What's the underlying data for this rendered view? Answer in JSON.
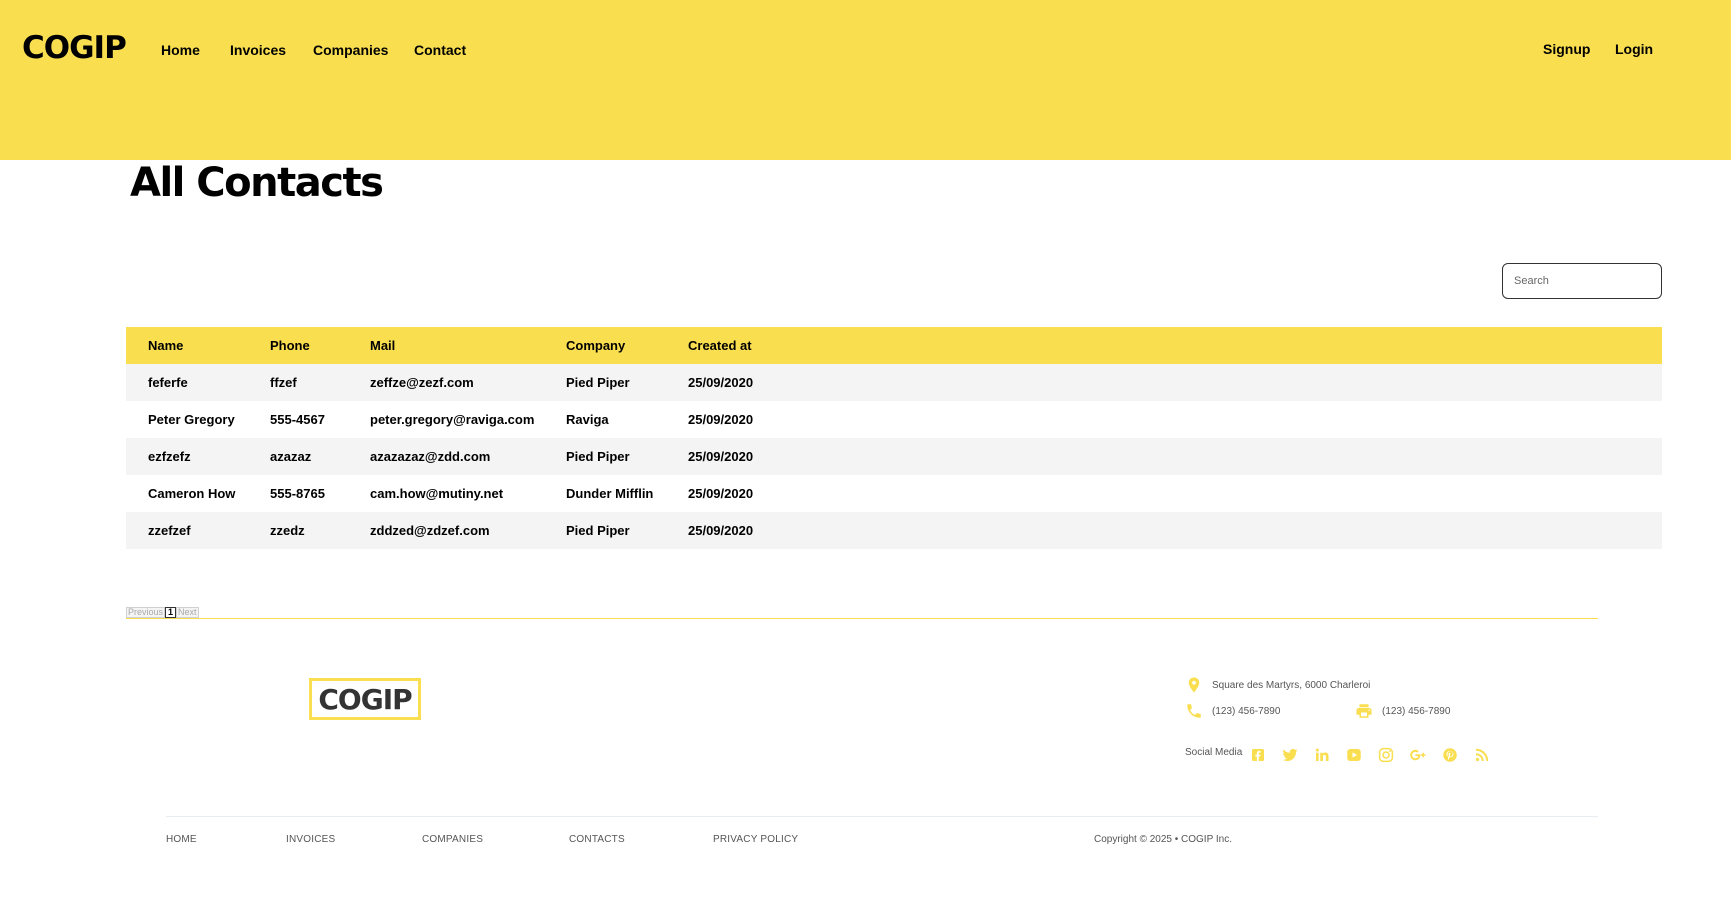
{
  "header": {
    "brand": "COGIP",
    "nav": [
      "Home",
      "Invoices",
      "Companies",
      "Contact"
    ],
    "auth": {
      "signup": "Signup",
      "login": "Login"
    },
    "background_color": "#f9de4f"
  },
  "page": {
    "title": "All Contacts",
    "search_placeholder": "Search"
  },
  "table": {
    "columns": [
      "Name",
      "Phone",
      "Mail",
      "Company",
      "Created at"
    ],
    "rows": [
      [
        "feferfe",
        "ffzef",
        "zeffze@zezf.com",
        "Pied Piper",
        "25/09/2020"
      ],
      [
        "Peter Gregory",
        "555-4567",
        "peter.gregory@raviga.com",
        "Raviga",
        "25/09/2020"
      ],
      [
        "ezfzefz",
        "azazaz",
        "azazazaz@zdd.com",
        "Pied Piper",
        "25/09/2020"
      ],
      [
        "Cameron How",
        "555-8765",
        "cam.how@mutiny.net",
        "Dunder Mifflin",
        "25/09/2020"
      ],
      [
        "zzefzef",
        "zzedz",
        "zddzed@zdzef.com",
        "Pied Piper",
        "25/09/2020"
      ]
    ]
  },
  "pagination": {
    "previous": "Previous",
    "current": "1",
    "next": "Next"
  },
  "footer": {
    "logo": "COGIP",
    "address": "Square des Martyrs, 6000 Charleroi",
    "phone": "(123) 456-7890",
    "fax": "(123) 456-7890",
    "social_label": "Social Media",
    "social_icons": [
      "facebook-icon",
      "twitter-icon",
      "linkedin-icon",
      "youtube-icon",
      "instagram-icon",
      "google-plus-icon",
      "pinterest-icon",
      "rss-icon"
    ],
    "links": [
      "HOME",
      "INVOICES",
      "COMPANIES",
      "CONTACTS",
      "PRIVACY POLICY"
    ],
    "copyright": "Copyright © 2025 • COGIP Inc.",
    "accent_color": "#f9de4f"
  }
}
